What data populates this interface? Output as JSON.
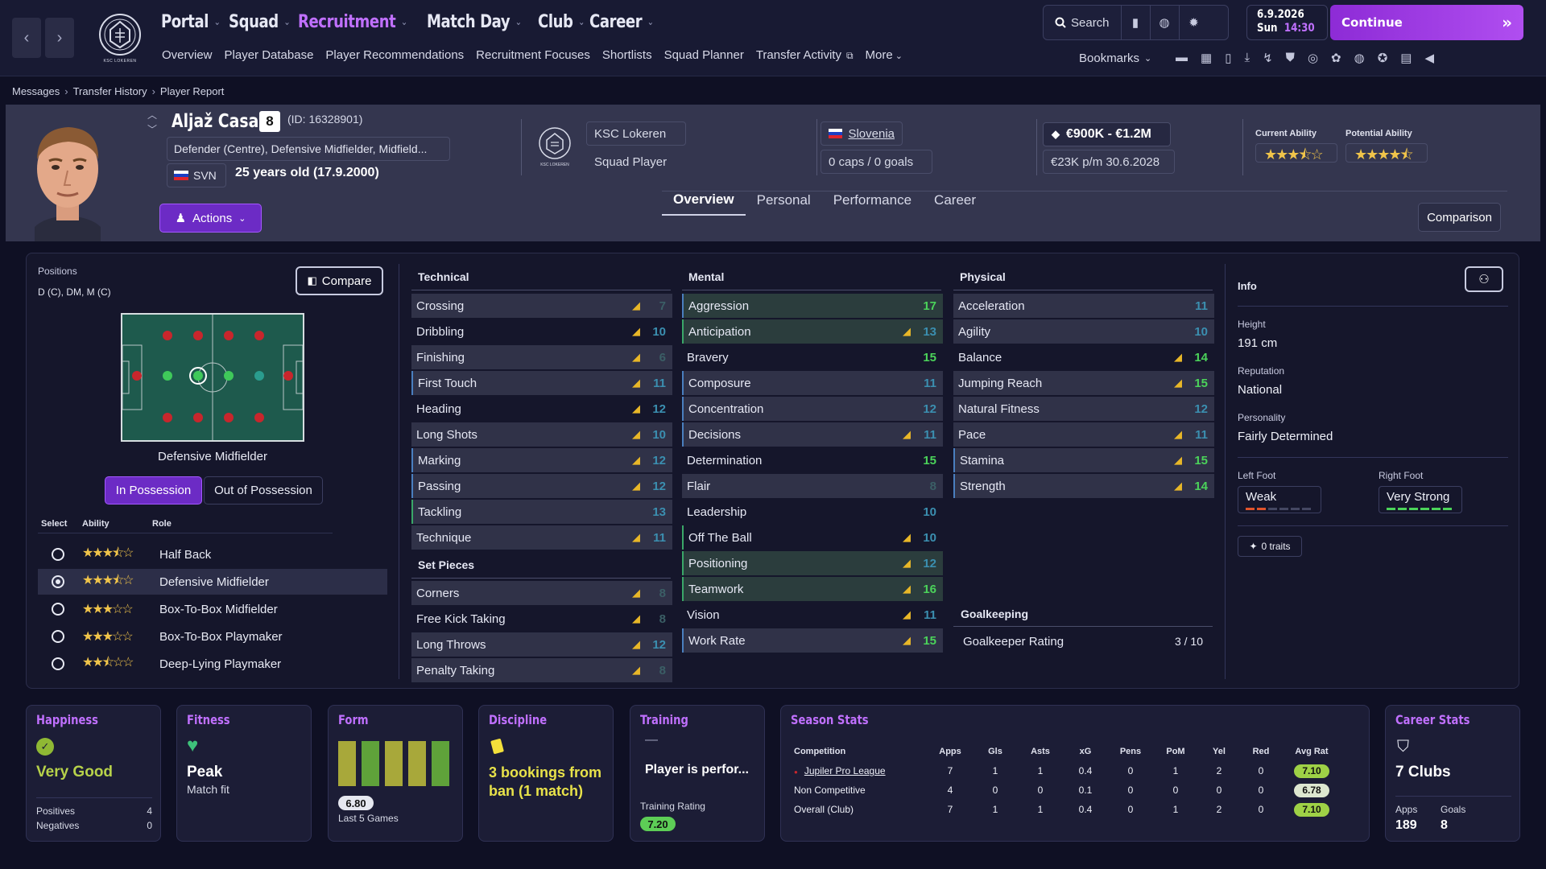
{
  "nav": {
    "main": [
      {
        "label": "Portal",
        "active": false
      },
      {
        "label": "Squad",
        "active": false
      },
      {
        "label": "Recruitment",
        "active": true
      },
      {
        "label": "Match Day",
        "active": false
      },
      {
        "label": "Club",
        "active": false
      },
      {
        "label": "Career",
        "active": false
      }
    ],
    "sub": [
      "Overview",
      "Player Database",
      "Player Recommendations",
      "Recruitment Focuses",
      "Shortlists",
      "Squad Planner",
      "Transfer Activity",
      "More"
    ],
    "search_label": "Search",
    "date": "6.9.2026",
    "day": "Sun",
    "time": "14:30",
    "continue_label": "Continue",
    "bookmarks_label": "Bookmarks",
    "crest_text": "KSC LOKEREN"
  },
  "breadcrumb": [
    "Messages",
    "Transfer History",
    "Player Report"
  ],
  "player": {
    "name": "Aljaž Casar",
    "number": "8",
    "id": "(ID: 16328901)",
    "positions_long": "Defender (Centre), Defensive Midfielder, Midfield...",
    "nationality_code": "SVN",
    "age": "25 years old (17.9.2000)",
    "actions_label": "Actions",
    "club": "KSC Lokeren",
    "club_crest_text": "KSC LOKEREN",
    "squad_status": "Squad Player",
    "country": "Slovenia",
    "caps": "0 caps / 0 goals",
    "value": "€900K - €1.2M",
    "contract": "€23K p/m 30.6.2028",
    "current_ability_label": "Current Ability",
    "potential_ability_label": "Potential Ability",
    "current_ability_stars": 3.5,
    "potential_ability_stars": 4.5
  },
  "tabs": [
    {
      "label": "Overview",
      "active": true
    },
    {
      "label": "Personal",
      "active": false
    },
    {
      "label": "Performance",
      "active": false
    },
    {
      "label": "Career",
      "active": false
    }
  ],
  "comparison_label": "Comparison",
  "positions": {
    "label": "Positions",
    "value": "D (C), DM, M (C)",
    "compare_label": "Compare",
    "role_name": "Defensive Midfielder",
    "in_possession": "In Possession",
    "out_of_possession": "Out of Possession",
    "headers": [
      "Select",
      "Ability",
      "Role"
    ],
    "roles": [
      {
        "name": "Half Back",
        "stars": 3.5,
        "selected": false
      },
      {
        "name": "Defensive Midfielder",
        "stars": 3.5,
        "selected": true
      },
      {
        "name": "Box-To-Box Midfielder",
        "stars": 3,
        "selected": false
      },
      {
        "name": "Box-To-Box Playmaker",
        "stars": 3,
        "selected": false
      },
      {
        "name": "Deep-Lying Playmaker",
        "stars": 2.5,
        "selected": false
      }
    ]
  },
  "attributes": {
    "technical_label": "Technical",
    "technical": [
      {
        "name": "Crossing",
        "value": "7",
        "arrow": true
      },
      {
        "name": "Dribbling",
        "value": "10",
        "arrow": true
      },
      {
        "name": "Finishing",
        "value": "6",
        "arrow": true
      },
      {
        "name": "First Touch",
        "value": "11",
        "arrow": true
      },
      {
        "name": "Heading",
        "value": "12",
        "arrow": true
      },
      {
        "name": "Long Shots",
        "value": "10",
        "arrow": true
      },
      {
        "name": "Marking",
        "value": "12",
        "arrow": true
      },
      {
        "name": "Passing",
        "value": "12",
        "arrow": true
      },
      {
        "name": "Tackling",
        "value": "13",
        "arrow": false
      },
      {
        "name": "Technique",
        "value": "11",
        "arrow": true
      }
    ],
    "set_pieces_label": "Set Pieces",
    "set_pieces": [
      {
        "name": "Corners",
        "value": "8",
        "arrow": true
      },
      {
        "name": "Free Kick Taking",
        "value": "8",
        "arrow": true
      },
      {
        "name": "Long Throws",
        "value": "12",
        "arrow": true
      },
      {
        "name": "Penalty Taking",
        "value": "8",
        "arrow": true
      }
    ],
    "mental_label": "Mental",
    "mental": [
      {
        "name": "Aggression",
        "value": "17",
        "arrow": false
      },
      {
        "name": "Anticipation",
        "value": "13",
        "arrow": true
      },
      {
        "name": "Bravery",
        "value": "15",
        "arrow": false
      },
      {
        "name": "Composure",
        "value": "11",
        "arrow": false
      },
      {
        "name": "Concentration",
        "value": "12",
        "arrow": false
      },
      {
        "name": "Decisions",
        "value": "11",
        "arrow": true
      },
      {
        "name": "Determination",
        "value": "15",
        "arrow": false
      },
      {
        "name": "Flair",
        "value": "8",
        "arrow": false
      },
      {
        "name": "Leadership",
        "value": "10",
        "arrow": false
      },
      {
        "name": "Off The Ball",
        "value": "10",
        "arrow": true
      },
      {
        "name": "Positioning",
        "value": "12",
        "arrow": true
      },
      {
        "name": "Teamwork",
        "value": "16",
        "arrow": true
      },
      {
        "name": "Vision",
        "value": "11",
        "arrow": true
      },
      {
        "name": "Work Rate",
        "value": "15",
        "arrow": true
      }
    ],
    "physical_label": "Physical",
    "physical": [
      {
        "name": "Acceleration",
        "value": "11",
        "arrow": false
      },
      {
        "name": "Agility",
        "value": "10",
        "arrow": false
      },
      {
        "name": "Balance",
        "value": "14",
        "arrow": true
      },
      {
        "name": "Jumping Reach",
        "value": "15",
        "arrow": true
      },
      {
        "name": "Natural Fitness",
        "value": "12",
        "arrow": false
      },
      {
        "name": "Pace",
        "value": "11",
        "arrow": true
      },
      {
        "name": "Stamina",
        "value": "15",
        "arrow": true
      },
      {
        "name": "Strength",
        "value": "14",
        "arrow": true
      }
    ],
    "goalkeeping_label": "Goalkeeping",
    "gk_rating_label": "Goalkeeper Rating",
    "gk_rating_value": "3 / 10"
  },
  "info": {
    "title": "Info",
    "height_label": "Height",
    "height": "191 cm",
    "reputation_label": "Reputation",
    "reputation": "National",
    "personality_label": "Personality",
    "personality": "Fairly Determined",
    "left_foot_label": "Left Foot",
    "left_foot": "Weak",
    "left_foot_level": 2,
    "right_foot_label": "Right Foot",
    "right_foot": "Very Strong",
    "right_foot_level": 6,
    "traits": "0 traits"
  },
  "cards": {
    "happiness": {
      "title": "Happiness",
      "value": "Very Good",
      "positives_label": "Positives",
      "positives": "4",
      "negatives_label": "Negatives",
      "negatives": "0"
    },
    "fitness": {
      "title": "Fitness",
      "value": "Peak",
      "sub": "Match fit"
    },
    "form": {
      "title": "Form",
      "rating": "6.80",
      "sub": "Last 5 Games"
    },
    "discipline": {
      "title": "Discipline",
      "text": "3 bookings from ban (1 match)"
    },
    "training": {
      "title": "Training",
      "dash": "—",
      "text": "Player is perfor...",
      "rating_label": "Training Rating",
      "rating": "7.20"
    },
    "season": {
      "title": "Season Stats",
      "headers": [
        "Competition",
        "Apps",
        "Gls",
        "Asts",
        "xG",
        "Pens",
        "PoM",
        "Yel",
        "Red",
        "Avg Rat"
      ],
      "rows": [
        [
          "Jupiler Pro League",
          "7",
          "1",
          "1",
          "0.4",
          "0",
          "1",
          "2",
          "0",
          "7.10"
        ],
        [
          "Non Competitive",
          "4",
          "0",
          "0",
          "0.1",
          "0",
          "0",
          "0",
          "0",
          "6.78"
        ],
        [
          "Overall (Club)",
          "7",
          "1",
          "1",
          "0.4",
          "0",
          "1",
          "2",
          "0",
          "7.10"
        ]
      ]
    },
    "career": {
      "title": "Career Stats",
      "clubs": "7 Clubs",
      "apps_label": "Apps",
      "apps": "189",
      "goals_label": "Goals",
      "goals": "8"
    }
  },
  "colors": {
    "accent": "#c070ff",
    "action": "#6c2bc5",
    "star": "#f0c44a",
    "green": "#4bd35a"
  }
}
